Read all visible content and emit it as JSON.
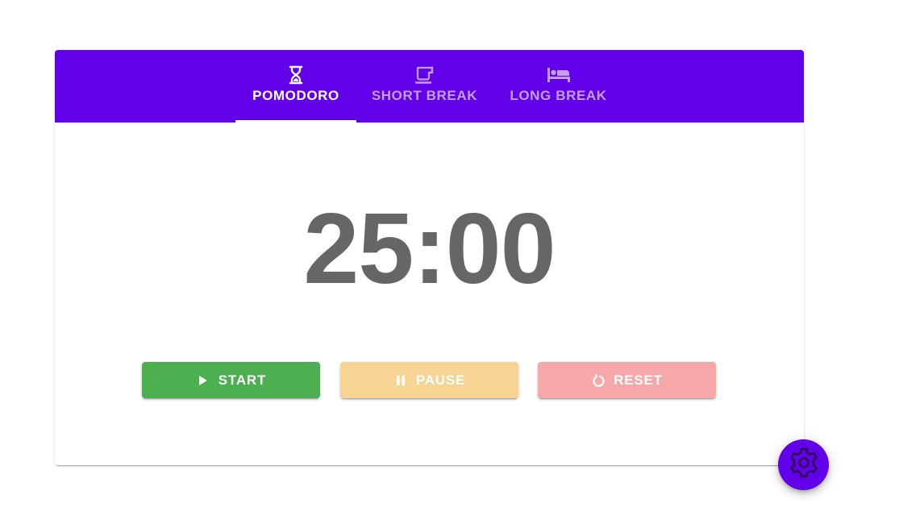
{
  "tabs": [
    {
      "label": "POMODORO",
      "icon": "hourglass-icon",
      "active": true
    },
    {
      "label": "SHORT BREAK",
      "icon": "coffee-cup-icon",
      "active": false
    },
    {
      "label": "LONG BREAK",
      "icon": "bed-icon",
      "active": false
    }
  ],
  "timer": {
    "display": "25:00"
  },
  "controls": {
    "start_label": "START",
    "pause_label": "PAUSE",
    "reset_label": "RESET"
  },
  "settings": {
    "icon": "gear-icon"
  },
  "colors": {
    "primary": "#6200ea",
    "start": "#4caf50",
    "pause": "#f8d494",
    "reset": "#f6a8a8",
    "timer_text": "#666666",
    "settings_icon": "#2a0a55"
  }
}
